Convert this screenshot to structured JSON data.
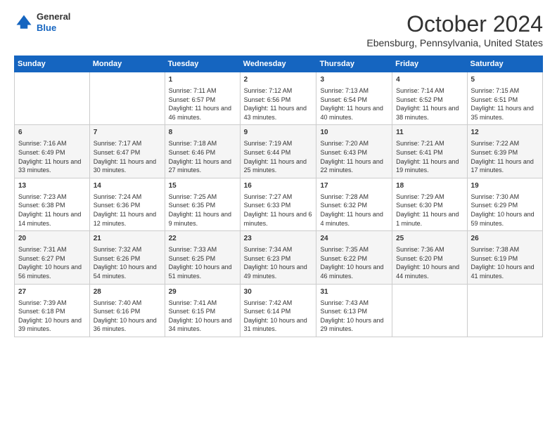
{
  "header": {
    "logo_general": "General",
    "logo_blue": "Blue",
    "title": "October 2024",
    "subtitle": "Ebensburg, Pennsylvania, United States"
  },
  "days_of_week": [
    "Sunday",
    "Monday",
    "Tuesday",
    "Wednesday",
    "Thursday",
    "Friday",
    "Saturday"
  ],
  "weeks": [
    [
      {
        "day": "",
        "sunrise": "",
        "sunset": "",
        "daylight": ""
      },
      {
        "day": "",
        "sunrise": "",
        "sunset": "",
        "daylight": ""
      },
      {
        "day": "1",
        "sunrise": "Sunrise: 7:11 AM",
        "sunset": "Sunset: 6:57 PM",
        "daylight": "Daylight: 11 hours and 46 minutes."
      },
      {
        "day": "2",
        "sunrise": "Sunrise: 7:12 AM",
        "sunset": "Sunset: 6:56 PM",
        "daylight": "Daylight: 11 hours and 43 minutes."
      },
      {
        "day": "3",
        "sunrise": "Sunrise: 7:13 AM",
        "sunset": "Sunset: 6:54 PM",
        "daylight": "Daylight: 11 hours and 40 minutes."
      },
      {
        "day": "4",
        "sunrise": "Sunrise: 7:14 AM",
        "sunset": "Sunset: 6:52 PM",
        "daylight": "Daylight: 11 hours and 38 minutes."
      },
      {
        "day": "5",
        "sunrise": "Sunrise: 7:15 AM",
        "sunset": "Sunset: 6:51 PM",
        "daylight": "Daylight: 11 hours and 35 minutes."
      }
    ],
    [
      {
        "day": "6",
        "sunrise": "Sunrise: 7:16 AM",
        "sunset": "Sunset: 6:49 PM",
        "daylight": "Daylight: 11 hours and 33 minutes."
      },
      {
        "day": "7",
        "sunrise": "Sunrise: 7:17 AM",
        "sunset": "Sunset: 6:47 PM",
        "daylight": "Daylight: 11 hours and 30 minutes."
      },
      {
        "day": "8",
        "sunrise": "Sunrise: 7:18 AM",
        "sunset": "Sunset: 6:46 PM",
        "daylight": "Daylight: 11 hours and 27 minutes."
      },
      {
        "day": "9",
        "sunrise": "Sunrise: 7:19 AM",
        "sunset": "Sunset: 6:44 PM",
        "daylight": "Daylight: 11 hours and 25 minutes."
      },
      {
        "day": "10",
        "sunrise": "Sunrise: 7:20 AM",
        "sunset": "Sunset: 6:43 PM",
        "daylight": "Daylight: 11 hours and 22 minutes."
      },
      {
        "day": "11",
        "sunrise": "Sunrise: 7:21 AM",
        "sunset": "Sunset: 6:41 PM",
        "daylight": "Daylight: 11 hours and 19 minutes."
      },
      {
        "day": "12",
        "sunrise": "Sunrise: 7:22 AM",
        "sunset": "Sunset: 6:39 PM",
        "daylight": "Daylight: 11 hours and 17 minutes."
      }
    ],
    [
      {
        "day": "13",
        "sunrise": "Sunrise: 7:23 AM",
        "sunset": "Sunset: 6:38 PM",
        "daylight": "Daylight: 11 hours and 14 minutes."
      },
      {
        "day": "14",
        "sunrise": "Sunrise: 7:24 AM",
        "sunset": "Sunset: 6:36 PM",
        "daylight": "Daylight: 11 hours and 12 minutes."
      },
      {
        "day": "15",
        "sunrise": "Sunrise: 7:25 AM",
        "sunset": "Sunset: 6:35 PM",
        "daylight": "Daylight: 11 hours and 9 minutes."
      },
      {
        "day": "16",
        "sunrise": "Sunrise: 7:27 AM",
        "sunset": "Sunset: 6:33 PM",
        "daylight": "Daylight: 11 hours and 6 minutes."
      },
      {
        "day": "17",
        "sunrise": "Sunrise: 7:28 AM",
        "sunset": "Sunset: 6:32 PM",
        "daylight": "Daylight: 11 hours and 4 minutes."
      },
      {
        "day": "18",
        "sunrise": "Sunrise: 7:29 AM",
        "sunset": "Sunset: 6:30 PM",
        "daylight": "Daylight: 11 hours and 1 minute."
      },
      {
        "day": "19",
        "sunrise": "Sunrise: 7:30 AM",
        "sunset": "Sunset: 6:29 PM",
        "daylight": "Daylight: 10 hours and 59 minutes."
      }
    ],
    [
      {
        "day": "20",
        "sunrise": "Sunrise: 7:31 AM",
        "sunset": "Sunset: 6:27 PM",
        "daylight": "Daylight: 10 hours and 56 minutes."
      },
      {
        "day": "21",
        "sunrise": "Sunrise: 7:32 AM",
        "sunset": "Sunset: 6:26 PM",
        "daylight": "Daylight: 10 hours and 54 minutes."
      },
      {
        "day": "22",
        "sunrise": "Sunrise: 7:33 AM",
        "sunset": "Sunset: 6:25 PM",
        "daylight": "Daylight: 10 hours and 51 minutes."
      },
      {
        "day": "23",
        "sunrise": "Sunrise: 7:34 AM",
        "sunset": "Sunset: 6:23 PM",
        "daylight": "Daylight: 10 hours and 49 minutes."
      },
      {
        "day": "24",
        "sunrise": "Sunrise: 7:35 AM",
        "sunset": "Sunset: 6:22 PM",
        "daylight": "Daylight: 10 hours and 46 minutes."
      },
      {
        "day": "25",
        "sunrise": "Sunrise: 7:36 AM",
        "sunset": "Sunset: 6:20 PM",
        "daylight": "Daylight: 10 hours and 44 minutes."
      },
      {
        "day": "26",
        "sunrise": "Sunrise: 7:38 AM",
        "sunset": "Sunset: 6:19 PM",
        "daylight": "Daylight: 10 hours and 41 minutes."
      }
    ],
    [
      {
        "day": "27",
        "sunrise": "Sunrise: 7:39 AM",
        "sunset": "Sunset: 6:18 PM",
        "daylight": "Daylight: 10 hours and 39 minutes."
      },
      {
        "day": "28",
        "sunrise": "Sunrise: 7:40 AM",
        "sunset": "Sunset: 6:16 PM",
        "daylight": "Daylight: 10 hours and 36 minutes."
      },
      {
        "day": "29",
        "sunrise": "Sunrise: 7:41 AM",
        "sunset": "Sunset: 6:15 PM",
        "daylight": "Daylight: 10 hours and 34 minutes."
      },
      {
        "day": "30",
        "sunrise": "Sunrise: 7:42 AM",
        "sunset": "Sunset: 6:14 PM",
        "daylight": "Daylight: 10 hours and 31 minutes."
      },
      {
        "day": "31",
        "sunrise": "Sunrise: 7:43 AM",
        "sunset": "Sunset: 6:13 PM",
        "daylight": "Daylight: 10 hours and 29 minutes."
      },
      {
        "day": "",
        "sunrise": "",
        "sunset": "",
        "daylight": ""
      },
      {
        "day": "",
        "sunrise": "",
        "sunset": "",
        "daylight": ""
      }
    ]
  ]
}
